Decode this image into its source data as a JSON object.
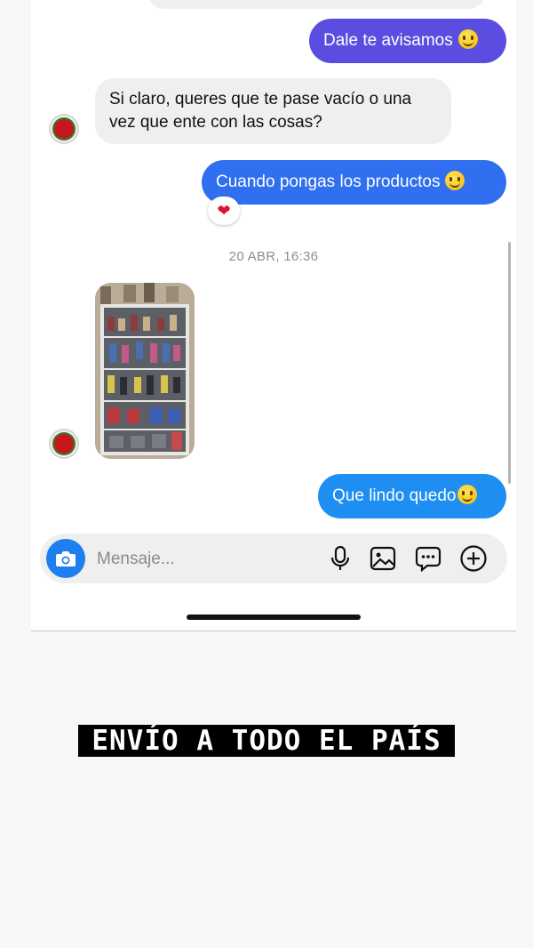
{
  "colors": {
    "outgoing_bubble_purple": "#5b4de0",
    "outgoing_bubble_blue": "#2f6ff0",
    "outgoing_bubble_light_blue": "#1e8ef2",
    "incoming_bubble": "#efefef",
    "camera_button": "#1d7ff0",
    "reaction_heart": "#e0102f"
  },
  "chat": {
    "messages": [
      {
        "direction": "outgoing",
        "text": "Dale te avisamos",
        "emoji": "grinning-face"
      },
      {
        "direction": "incoming",
        "line1": "Si claro, queres que te pase vacío o una",
        "line2": "vez que ente con las cosas?"
      },
      {
        "direction": "outgoing",
        "text": "Cuando pongas los productos",
        "emoji": "star-struck-face",
        "reaction": "❤"
      },
      {
        "direction": "incoming",
        "type": "photo",
        "description_icon": "store-shelf-photo"
      },
      {
        "direction": "outgoing",
        "text": "Que lindo quedo",
        "emoji": "star-struck-face"
      }
    ],
    "timestamp": "20 ABR, 16:36"
  },
  "composer": {
    "placeholder": "Mensaje...",
    "icons": [
      "camera-icon",
      "microphone-icon",
      "gallery-icon",
      "sticker-chat-icon",
      "add-circle-icon"
    ]
  },
  "banner": {
    "text": "ENVÍO A TODO EL PAÍS"
  }
}
